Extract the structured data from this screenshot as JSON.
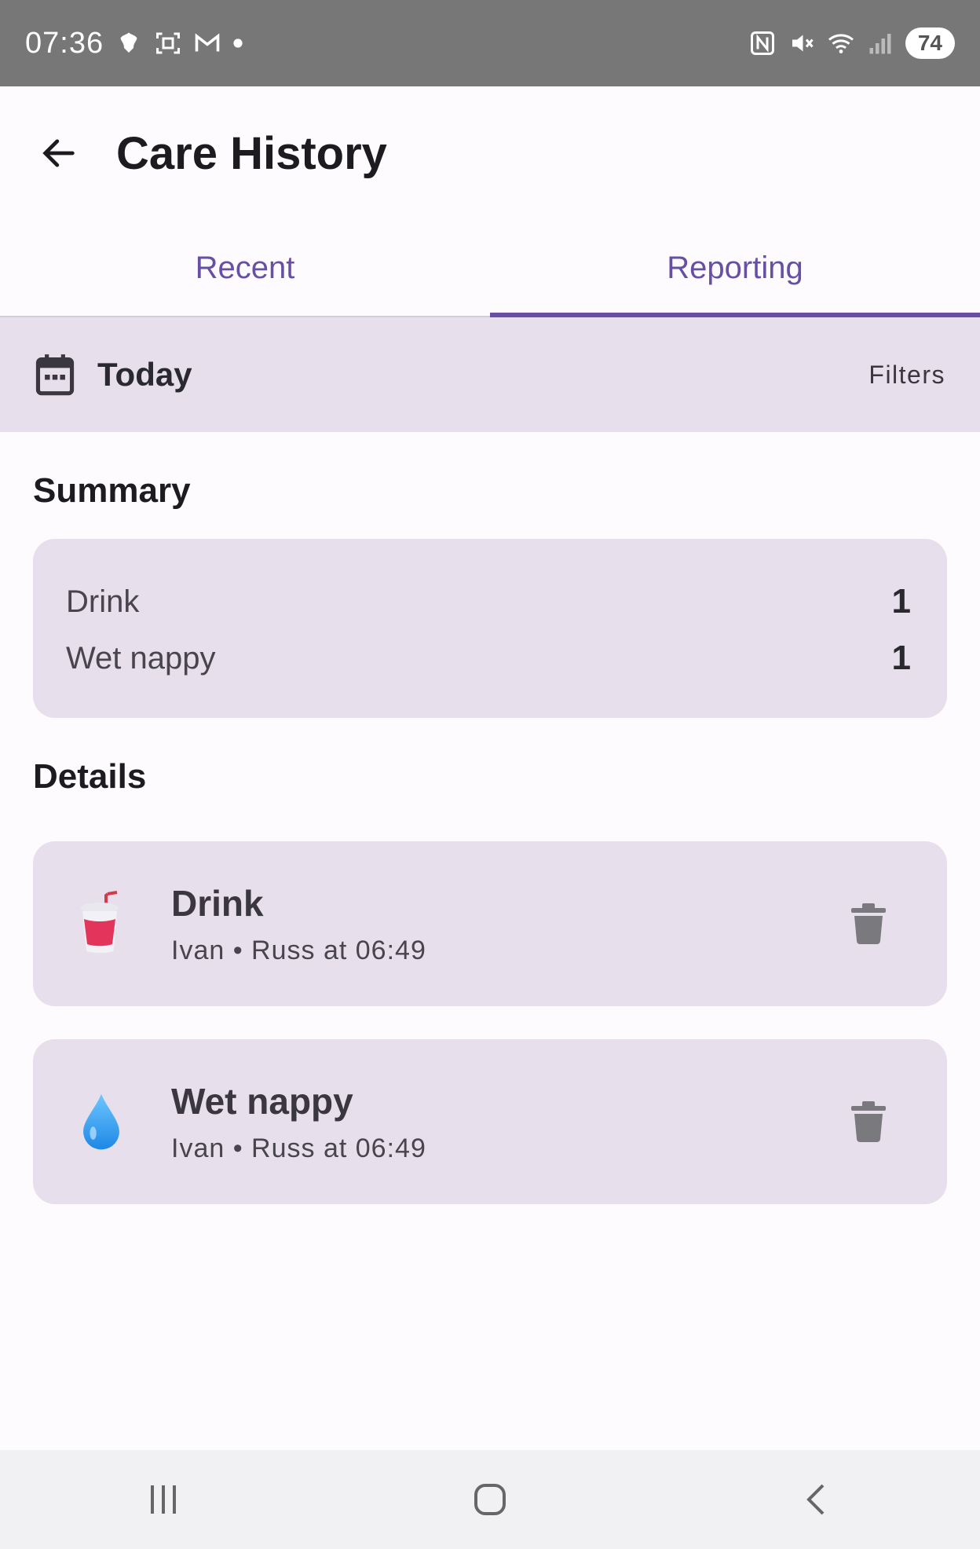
{
  "status_bar": {
    "time": "07:36",
    "battery": "74",
    "icons": [
      "barclays-eagle-icon",
      "screenshot-icon",
      "gmail-icon",
      "dot-icon",
      "nfc-icon",
      "mute-icon",
      "wifi-icon",
      "signal-icon"
    ]
  },
  "header": {
    "title": "Care History",
    "back_icon": "arrow-left-icon"
  },
  "tabs": [
    {
      "label": "Recent",
      "active": false
    },
    {
      "label": "Reporting",
      "active": true
    }
  ],
  "date_bar": {
    "label": "Today",
    "icon": "calendar-icon",
    "filters_label": "Filters"
  },
  "summary": {
    "title": "Summary",
    "rows": [
      {
        "label": "Drink",
        "count": "1"
      },
      {
        "label": "Wet nappy",
        "count": "1"
      }
    ]
  },
  "details": {
    "title": "Details",
    "items": [
      {
        "emoji": "cup-with-straw-icon",
        "title": "Drink",
        "subtitle": "Ivan • Russ at 06:49"
      },
      {
        "emoji": "droplet-icon",
        "title": "Wet nappy",
        "subtitle": "Ivan • Russ at 06:49"
      }
    ]
  },
  "colors": {
    "accent": "#6750a4",
    "surface_variant": "#e7e0ec",
    "status_bar": "#777777"
  }
}
